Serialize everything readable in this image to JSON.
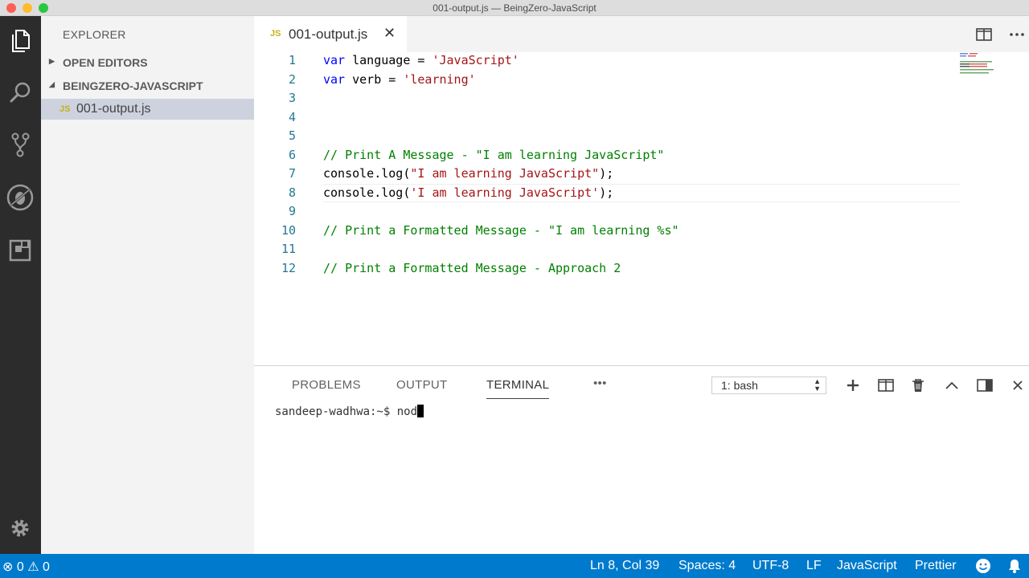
{
  "window": {
    "title": "001-output.js — BeingZero-JavaScript"
  },
  "activity_bar": {
    "icons": [
      "files-icon",
      "search-icon",
      "source-control-icon",
      "debug-icon",
      "extensions-icon",
      "settings-gear-icon"
    ]
  },
  "sidebar": {
    "header": "EXPLORER",
    "sections": [
      {
        "label": "OPEN EDITORS",
        "expanded": false
      },
      {
        "label": "BEINGZERO-JAVASCRIPT",
        "expanded": true
      }
    ],
    "files": [
      {
        "badge": "JS",
        "name": "001-output.js",
        "selected": true
      }
    ]
  },
  "tabs": [
    {
      "badge": "JS",
      "name": "001-output.js",
      "close": "✕",
      "active": true
    }
  ],
  "editor": {
    "line_numbers": [
      "1",
      "2",
      "3",
      "4",
      "5",
      "6",
      "7",
      "8",
      "9",
      "10",
      "11",
      "12"
    ],
    "lines": {
      "l1": {
        "kw": "var",
        "rest": " language = ",
        "str": "'JavaScript'"
      },
      "l2": {
        "kw": "var",
        "rest": " verb = ",
        "str": "'learning'"
      },
      "l6": {
        "comment": "// Print A Message - \"I am learning JavaScript\""
      },
      "l7": {
        "pre": "console.log(",
        "str": "\"I am learning JavaScript\"",
        "post": ");"
      },
      "l8": {
        "pre": "console.log(",
        "str": "'I am learning JavaScript'",
        "post": ");"
      },
      "l10": {
        "comment": "// Print a Formatted Message - \"I am learning %s\""
      },
      "l12": {
        "comment": "// Print a Formatted Message - Approach 2"
      }
    },
    "current_line": 8
  },
  "panel": {
    "tabs": [
      {
        "label": "PROBLEMS",
        "active": false
      },
      {
        "label": "OUTPUT",
        "active": false
      },
      {
        "label": "TERMINAL",
        "active": true
      }
    ],
    "more": "•••",
    "terminal_select": "1: bash",
    "terminal": {
      "prompt": "sandeep-wadhwa:~$ ",
      "input": "nod"
    }
  },
  "statusbar": {
    "errors": "0",
    "warnings": "0",
    "position": "Ln 8, Col 39",
    "spaces": "Spaces: 4",
    "encoding": "UTF-8",
    "eol": "LF",
    "language": "JavaScript",
    "formatter": "Prettier"
  },
  "colors": {
    "accent": "#007acc",
    "activity_bar": "#2c2c2c",
    "keyword": "#0000ff",
    "string": "#a31515",
    "comment": "#008000"
  }
}
